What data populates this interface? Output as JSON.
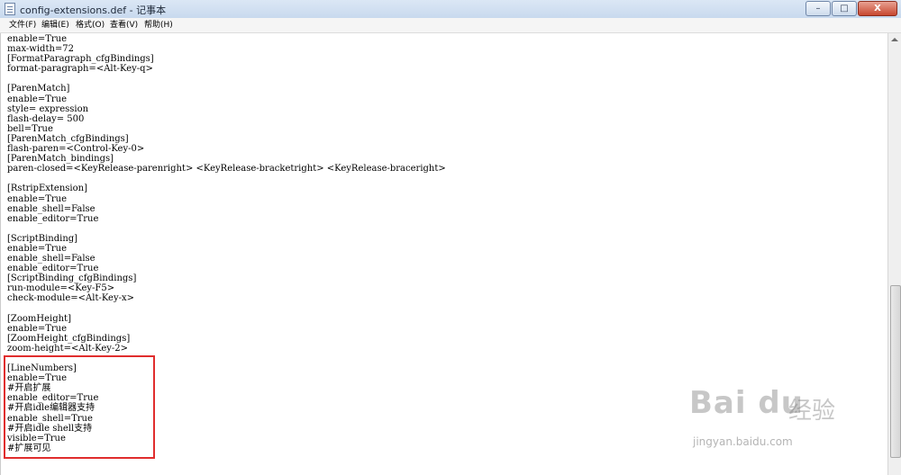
{
  "window": {
    "title": "config-extensions.def - 记事本",
    "controls": {
      "minimize": "–",
      "maximize": "□",
      "close": "X"
    }
  },
  "menubar": {
    "items": [
      "文件(F)",
      "编辑(E)",
      "格式(O)",
      "查看(V)",
      "帮助(H)"
    ]
  },
  "editor": {
    "content": "enable=True\nmax-width=72\n[FormatParagraph_cfgBindings]\nformat-paragraph=<Alt-Key-q>\n\n[ParenMatch]\nenable=True\nstyle= expression\nflash-delay= 500\nbell=True\n[ParenMatch_cfgBindings]\nflash-paren=<Control-Key-0>\n[ParenMatch_bindings]\nparen-closed=<KeyRelease-parenright> <KeyRelease-bracketright> <KeyRelease-braceright>\n\n[RstripExtension]\nenable=True\nenable_shell=False\nenable_editor=True\n\n[ScriptBinding]\nenable=True\nenable_shell=False\nenable_editor=True\n[ScriptBinding_cfgBindings]\nrun-module=<Key-F5>\ncheck-module=<Alt-Key-x>\n\n[ZoomHeight]\nenable=True\n[ZoomHeight_cfgBindings]\nzoom-height=<Alt-Key-2>\n\n[LineNumbers]\nenable=True\n#开启扩展\nenable_editor=True\n#开启idle编辑器支持\nenable_shell=True\n#开启idle shell支持\nvisible=True\n#扩展可见"
  },
  "watermark": {
    "logo": "Bai du",
    "service": "经验",
    "url": "jingyan.baidu.com"
  },
  "colors": {
    "highlight": "#e02d2d",
    "titlebar": "#dbe7f5"
  }
}
